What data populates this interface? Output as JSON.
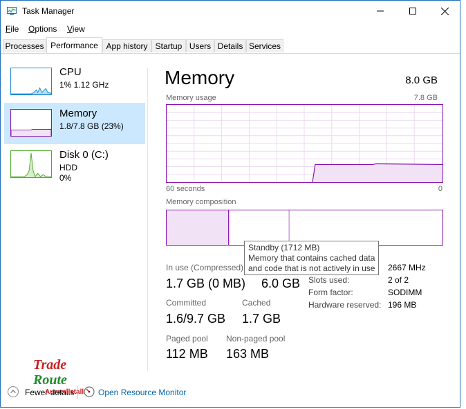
{
  "window": {
    "title": "Task Manager"
  },
  "menu": [
    {
      "label": "File",
      "u": "F",
      "rest": "ile"
    },
    {
      "label": "Options",
      "u": "O",
      "rest": "ptions"
    },
    {
      "label": "View",
      "u": "V",
      "rest": "iew"
    }
  ],
  "tabs": [
    "Processes",
    "Performance",
    "App history",
    "Startup",
    "Users",
    "Details",
    "Services"
  ],
  "sidebar": {
    "items": [
      {
        "title": "CPU",
        "line1": "1% 1.12 GHz",
        "line2": ""
      },
      {
        "title": "Memory",
        "line1": "1.8/7.8 GB (23%)",
        "line2": ""
      },
      {
        "title": "Disk 0 (C:)",
        "line1": "HDD",
        "line2": "0%"
      }
    ]
  },
  "main": {
    "title": "Memory",
    "total": "8.0 GB",
    "usage_label": "Memory usage",
    "usage_max": "7.8 GB",
    "time_left": "60 seconds",
    "time_right": "0",
    "composition_label": "Memory composition"
  },
  "tooltip": {
    "line1": "Standby (1712 MB)",
    "line2": "Memory that contains cached data",
    "line3": "and code that is not actively in use"
  },
  "stats": {
    "in_use_label": "In use (Compressed)",
    "in_use_value": "1.7 GB (0 MB)",
    "available_value": "6.0 GB",
    "committed_label": "Committed",
    "committed_value": "1.6/9.7 GB",
    "cached_label": "Cached",
    "cached_value": "1.7 GB",
    "paged_label": "Paged pool",
    "paged_value": "112 MB",
    "nonpaged_label": "Non-paged pool",
    "nonpaged_value": "163 MB"
  },
  "hardware": [
    {
      "label": "",
      "value": "2667 MHz"
    },
    {
      "label": "Slots used:",
      "value": "2 of 2"
    },
    {
      "label": "Form factor:",
      "value": "SODIMM"
    },
    {
      "label": "Hardware reserved:",
      "value": "196 MB"
    }
  ],
  "footer": {
    "fewer_details": "Fewer details",
    "open_resource_monitor": "Open Resource Monitor"
  },
  "watermark": {
    "line1": "Trade",
    "line2": "Route",
    "line3": "Aurarrlistalls"
  },
  "colors": {
    "memory_accent": "#8b12ae",
    "cpu_accent": "#1a8ad4",
    "disk_accent": "#4caf2a",
    "selected_bg": "#cce8ff"
  }
}
